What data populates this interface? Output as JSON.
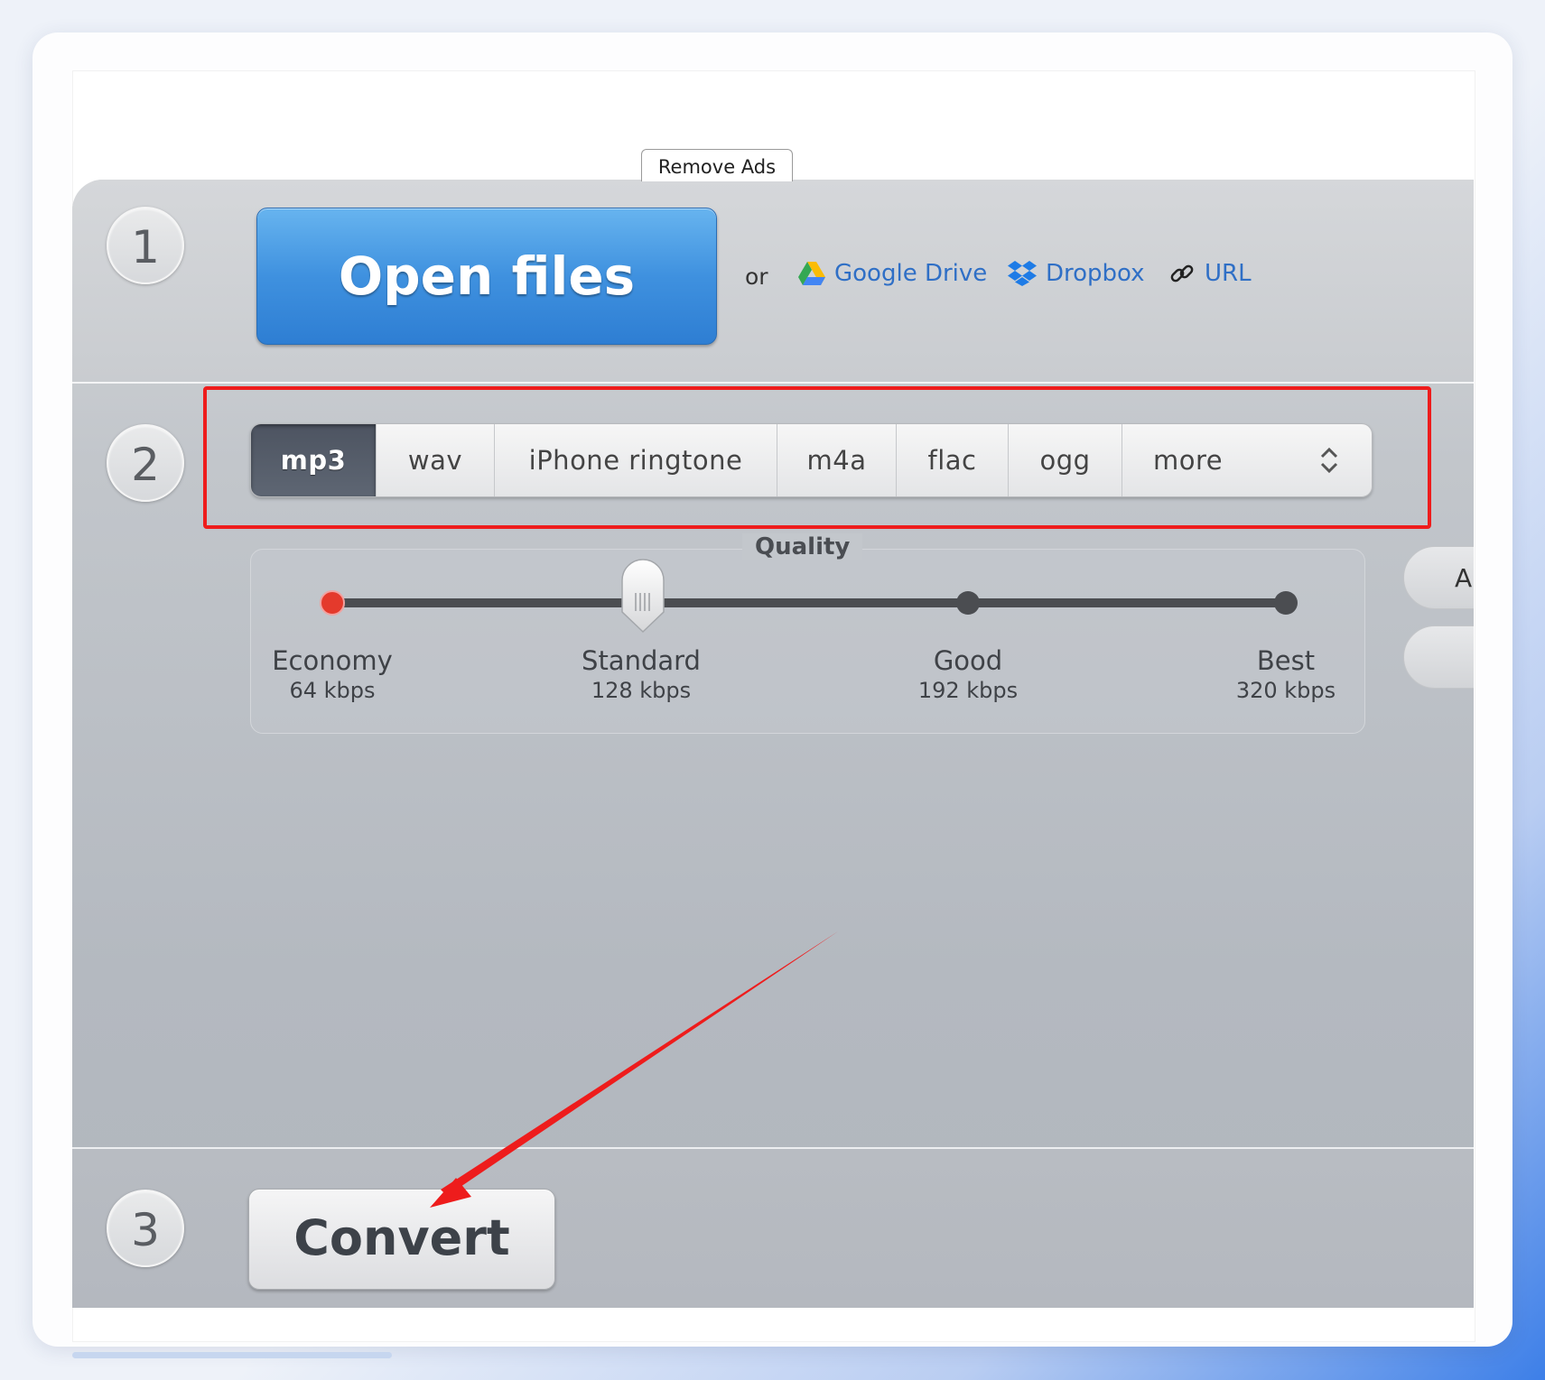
{
  "banner": {
    "remove_ads": "Remove Ads"
  },
  "step1": {
    "number": "1",
    "open_files": "Open files",
    "or_text": "or",
    "sources": [
      {
        "label": "Google Drive",
        "icon": "google-drive-icon"
      },
      {
        "label": "Dropbox",
        "icon": "dropbox-icon"
      },
      {
        "label": "URL",
        "icon": "link-icon"
      }
    ]
  },
  "step2": {
    "number": "2",
    "formats": [
      "mp3",
      "wav",
      "iPhone ringtone",
      "m4a",
      "flac",
      "ogg",
      "more"
    ],
    "selected_format": "mp3",
    "quality": {
      "title": "Quality",
      "selected_index": 1,
      "levels": [
        {
          "name": "Economy",
          "bitrate": "64 kbps"
        },
        {
          "name": "Standard",
          "bitrate": "128 kbps"
        },
        {
          "name": "Good",
          "bitrate": "192 kbps"
        },
        {
          "name": "Best",
          "bitrate": "320 kbps"
        }
      ]
    },
    "side_button_partial": "A"
  },
  "step3": {
    "number": "3",
    "convert": "Convert"
  },
  "colors": {
    "highlight_box": "#ee1c1c",
    "annotation_arrow": "#ee1c1c",
    "primary_button": "#3f91df",
    "link": "#2f6fc6",
    "selected_format_bg": "#4d5461"
  }
}
